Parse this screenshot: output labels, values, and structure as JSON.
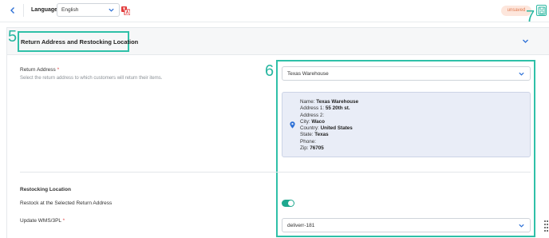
{
  "header": {
    "back_icon": "chevron-left-icon",
    "language_label": "Language",
    "language_value": "English",
    "translate_icon": "translate-icon",
    "status_badge": "unsaved",
    "save_icon": "save-icon",
    "annotation_seven": "7"
  },
  "section": {
    "annotation_five": "5",
    "title": "Return Address and Restocking Location",
    "collapse_icon": "chevron-down-icon"
  },
  "return_address": {
    "label": "Return Address",
    "required_mark": "*",
    "help": "Select the return address to which customers will return their items.",
    "annotation_six": "6",
    "selected": "Texas Warehouse",
    "card": {
      "name_label": "Name:",
      "name_value": "Texas Warehouse",
      "address1_label": "Address 1:",
      "address1_value": "55 20th st.",
      "address2_label": "Address 2:",
      "city_label": "City:",
      "city_value": "Waco",
      "country_label": "Country:",
      "country_value": "United States",
      "state_label": "State:",
      "state_value": "Texas",
      "phone_label": "Phone:",
      "zip_label": "Zip:",
      "zip_value": "76705"
    }
  },
  "restocking": {
    "title": "Restocking Location",
    "restock_label": "Restock at the Selected Return Address",
    "restock_enabled": true,
    "wms_label": "Update WMS/3PL",
    "wms_required_mark": "*",
    "wms_selected": "deliverr-181"
  },
  "colors": {
    "accent": "#2fc0a8",
    "toggle_on": "#1ea88f",
    "link_blue": "#2b6fd6",
    "badge_bg": "#fde6dc",
    "badge_text": "#e07a4f",
    "card_bg": "#e9edf7"
  }
}
